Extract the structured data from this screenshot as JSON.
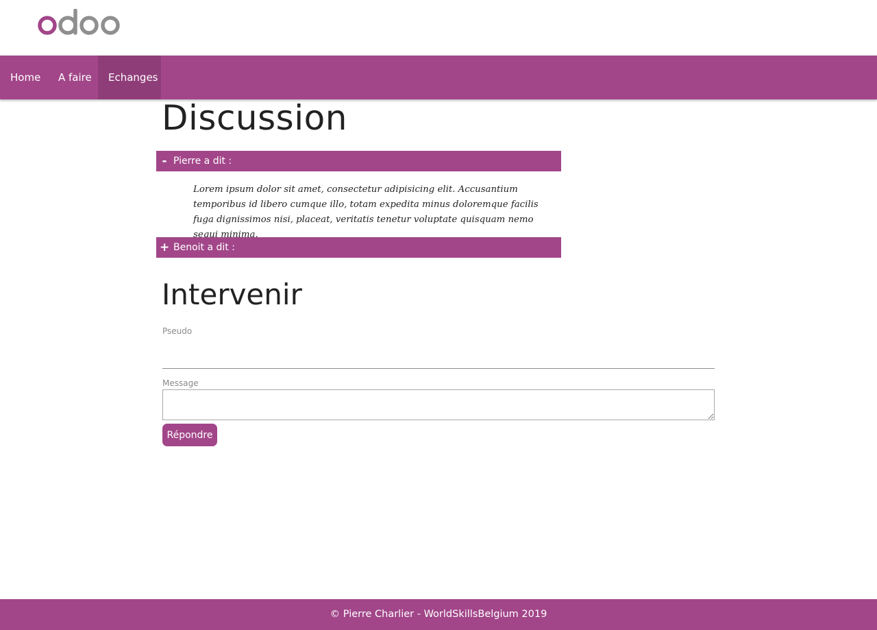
{
  "brand": {
    "logo_icon": "odoo-logo",
    "accent_color": "#a24689",
    "logo_gray": "#8f8f8f"
  },
  "nav": {
    "items": [
      {
        "label": "Home"
      },
      {
        "label": "A faire"
      },
      {
        "label": "Echanges",
        "active": true
      }
    ]
  },
  "discussion": {
    "title": "Discussion",
    "entries": [
      {
        "toggle": "-",
        "author_label": "Pierre a dit :",
        "expanded": true,
        "body": "Lorem ipsum dolor sit amet, consectetur adipisicing elit. Accusantium temporibus id libero cumque illo, totam expedita minus doloremque facilis fuga dignissimos nisi, placeat, veritatis tenetur voluptate quisquam nemo sequi minima."
      },
      {
        "toggle": "+",
        "author_label": "Benoit a dit :",
        "expanded": false
      }
    ]
  },
  "form": {
    "title": "Intervenir",
    "pseudo_label": "Pseudo",
    "pseudo_value": "",
    "message_label": "Message",
    "message_value": "",
    "submit_label": "Répondre"
  },
  "footer": {
    "text": "© Pierre Charlier - WorldSkillsBelgium 2019"
  }
}
